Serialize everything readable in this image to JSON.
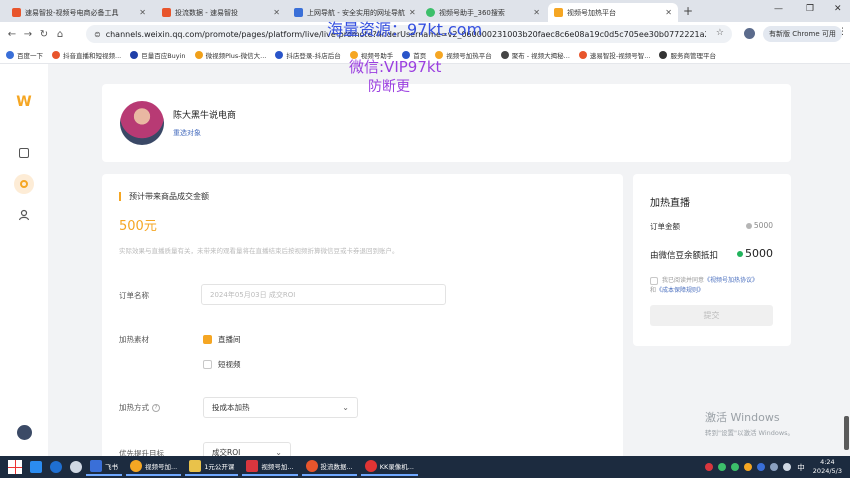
{
  "browser": {
    "tabs": [
      {
        "title": "速易智投-视频号电商必备工具",
        "active": false,
        "color": "#e8552c"
      },
      {
        "title": "投流数据 - 速易智投",
        "active": false,
        "color": "#e8552c"
      },
      {
        "title": "上网导航 - 安全实用的网址导航",
        "active": false,
        "color": "#3a6fd8"
      },
      {
        "title": "视频号助手_360搜索",
        "active": false,
        "color": "#3cbf6a"
      },
      {
        "title": "视频号加热平台",
        "active": true,
        "color": "#f5a623"
      }
    ],
    "new_tab": "+",
    "window_controls": {
      "minimize": "—",
      "restore": "❐",
      "close": "✕"
    },
    "url": "channels.weixin.qq.com/promote/pages/platform/live/live-promote?finderUsername=v2_060000231003b20faec8c6e08a19c0d5c705ee30b0772221a2b7d4d900e0...",
    "update_button": "有新版 Chrome 可用",
    "bookmarks": [
      {
        "label": "百度一下",
        "color": "#3a6fd8"
      },
      {
        "label": "抖音直播和短视频...",
        "color": "#e8552c"
      },
      {
        "label": "巨量百应Buyin",
        "color": "#1f3fa8"
      },
      {
        "label": "微视频Plus-微信大...",
        "color": "#f0a01a"
      },
      {
        "label": "抖店登录-抖店后台",
        "color": "#2a55c9"
      },
      {
        "label": "视频号助手",
        "color": "#f5a623"
      },
      {
        "label": "首页",
        "color": "#2a55c9"
      },
      {
        "label": "视频号加热平台",
        "color": "#f5a623"
      },
      {
        "label": "聚布 - 视频大揭秘...",
        "color": "#444"
      },
      {
        "label": "速易智投-视频号智...",
        "color": "#e8552c"
      },
      {
        "label": "服务商管理平台",
        "color": "#333"
      }
    ]
  },
  "watermark": {
    "line1": "海量资源：97kt.com",
    "line2": "微信:VIP97kt",
    "line3": "防断更"
  },
  "sidebar": {
    "logo": "W"
  },
  "creator": {
    "name": "陈大黑牛说电商",
    "reselect": "重选对象"
  },
  "form": {
    "section_title": "预计带来商品成交金额",
    "amount": "500元",
    "hint": "实际效果与直播质量有关，未带来的观看量将在直播结束后按视频折算微信豆或卡券退回到账户。",
    "order_name_label": "订单名称",
    "order_name_placeholder": "2024年05月03日 成交ROI",
    "material_label": "加热素材",
    "material_options": [
      {
        "label": "直播间",
        "checked": true
      },
      {
        "label": "短视频",
        "checked": false
      }
    ],
    "method_label": "加热方式",
    "method_value": "投成本加热",
    "target_label": "优先提升目标",
    "target_value": "成交ROI"
  },
  "summary": {
    "title": "加热直播",
    "order_amount_label": "订单金额",
    "order_amount_value": "5000",
    "pay_label": "由微信豆余额抵扣",
    "pay_value": "5000",
    "agree_prefix": "我已阅读并同意",
    "agree_link1": "《视频号加热协议》",
    "agree_mid": "和",
    "agree_link2": "《成本保障规则》",
    "submit": "提交"
  },
  "windows_activation": {
    "line1": "激活 Windows",
    "line2": "转到\"设置\"以激活 Windows。"
  },
  "taskbar": {
    "apps": [
      {
        "label": "飞书",
        "color": "#3a6fd8"
      },
      {
        "label": "视频号加...",
        "color": "#f5a623"
      },
      {
        "label": "1元公开课",
        "color": "#e9c24a"
      },
      {
        "label": "视频号加...",
        "color": "#d9363e"
      },
      {
        "label": "投流数据...",
        "color": "#e8552c"
      },
      {
        "label": "KK录像机...",
        "color": "#e03434"
      }
    ],
    "ime": "中",
    "time": "4:24",
    "date": "2024/5/3"
  }
}
